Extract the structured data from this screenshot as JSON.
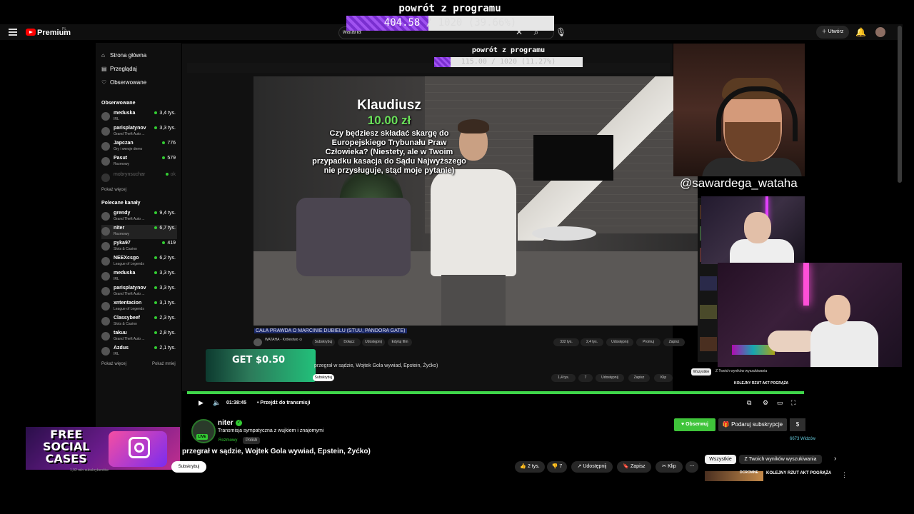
{
  "overlay": {
    "title": "powrót z programu",
    "progress_current": "404.58",
    "progress_rest": " / 1020 (39.66%)",
    "progress_fraction": 0.3966,
    "inner_title": "powrót z programu",
    "inner_progress_current": "115.00",
    "inner_progress_rest": " / 1020 (11.27%)",
    "inner_progress_fraction": 0.1127,
    "accent": "#7a2fd0"
  },
  "header": {
    "brand": "Premium",
    "brand_region": "PL",
    "search_value": "wataha",
    "create_label": "Utwórz",
    "icons": [
      "menu-icon",
      "search-icon",
      "mic-icon",
      "bell-icon",
      "close-icon"
    ]
  },
  "sidebar": {
    "nav": [
      {
        "icon": "⌂",
        "label": "Strona główna"
      },
      {
        "icon": "▤",
        "label": "Przeglądaj"
      },
      {
        "icon": "♡",
        "label": "Obserwowane"
      }
    ],
    "followed_title": "Obserwowane",
    "followed": [
      {
        "name": "meduska",
        "sub": "IRL",
        "viewers": "3,4 tys."
      },
      {
        "name": "parisplatynov",
        "sub": "Grand Theft Auto ...",
        "viewers": "3,3 tys."
      },
      {
        "name": "Japczan",
        "sub": "Gry i wersje demo",
        "viewers": "776"
      },
      {
        "name": "Pasut",
        "sub": "Rozmowy",
        "viewers": "579"
      }
    ],
    "offline_name": "mobrynsuchar",
    "show_more": "Pokaż więcej",
    "recommended_title": "Polecane kanały",
    "recommended": [
      {
        "name": "grendy",
        "sub": "Grand Theft Auto ...",
        "viewers": "9,4 tys."
      },
      {
        "name": "niter",
        "sub": "Rozmowy",
        "viewers": "6,7 tys.",
        "active": true
      },
      {
        "name": "pyka97",
        "sub": "Slots & Casino",
        "viewers": "419"
      },
      {
        "name": "NEEXcsgo",
        "sub": "League of Legends",
        "viewers": "6,2 tys."
      },
      {
        "name": "meduska",
        "sub": "IRL",
        "viewers": "3,3 tys."
      },
      {
        "name": "parisplatynov",
        "sub": "Grand Theft Auto ...",
        "viewers": "3,3 tys."
      },
      {
        "name": "xntentacion",
        "sub": "League of Legends",
        "viewers": "3,1 tys."
      },
      {
        "name": "Classybeef",
        "sub": "Slots & Casino",
        "viewers": "2,3 tys."
      },
      {
        "name": "takuu",
        "sub": "Grand Theft Auto ...",
        "viewers": "2,8 tys."
      },
      {
        "name": "Azdus",
        "sub": "IRL",
        "viewers": "2,1 tys."
      }
    ],
    "show_more2": "Pokaż więcej",
    "show_less": "Pokaż mniej"
  },
  "inner": {
    "donation_name": "Klaudiusz",
    "donation_amount": "10.00 zł",
    "donation_msg": "Czy będziesz składać skargę do Europejskiego Trybunału Praw Człowieka? (Niestety, ale w Twoim przypadku kasacja do Sądu Najwyższego nie przysługuje, stąd moje pytanie)",
    "video_title": "CAŁA PRAWDA O MARCINIE DUBIELU (STUU, PANDORA GATE)",
    "channel": "WATAHA - Królestwo ⊙",
    "pills": [
      "Subskrybuj",
      "Dołącz",
      "Udostępnij",
      "Edytuj film"
    ],
    "likes": "332 tys.",
    "dislikes": "2,4 tys.",
    "share": "Udostępnij",
    "promote": "Promuj",
    "save": "Zapisz",
    "ad_text": "GET $0.50",
    "row_title": "przegrał w sądzie, Wojtek Gola wywiad, Epstein, Żyćko)",
    "row_likes": "1,4 tys.",
    "row_dislikes": "7",
    "row_share": "Udostępnij",
    "row_save": "Zapisz",
    "row_clip": "Klip",
    "row_subscribe": "Subskrybuj"
  },
  "player": {
    "time": "01:38:45",
    "jump_label": "Przejdź do transmisji",
    "progress_fraction": 1.0,
    "progress_color": "#3fd64a"
  },
  "cams": {
    "handle": "@sawardega_wataha"
  },
  "right_inner": {
    "chips": [
      "Wszystkie",
      "Z Twoich wyników wyszukiwania"
    ],
    "reco": "KOLEJNY RZUT AKT POGRĄŻA"
  },
  "channel": {
    "name": "niter",
    "live_label": "LIVE",
    "description": "Transmisja sympatyczna z wujkiem i znajomymi",
    "tags": [
      "Rozmowy",
      "Polish"
    ],
    "follow_label": "Obserwuj",
    "gift_label": "Podaruj subskrypcje",
    "viewers": "6673 Widzów",
    "follow_color": "#3fc43a"
  },
  "ad": {
    "text": "FREE\nSOCIAL\nCASES"
  },
  "bottom": {
    "title": "przegrał w sądzie, Wojtek Gola wywiad, Epstein, Żyćko)",
    "subscribe": "Subskrybuj",
    "subscribers": "1,92 mln subskrybentów",
    "likes": "2 tys.",
    "dislikes": "7",
    "share": "Udostępnij",
    "save": "Zapisz",
    "clip": "Klip",
    "chips": [
      "Wszystkie",
      "Z Twoich wyników wyszukiwania"
    ],
    "reco_title": "KOLEJNY RZUT AKT POGRĄŻA",
    "reco_channel": "DCROMNE"
  }
}
